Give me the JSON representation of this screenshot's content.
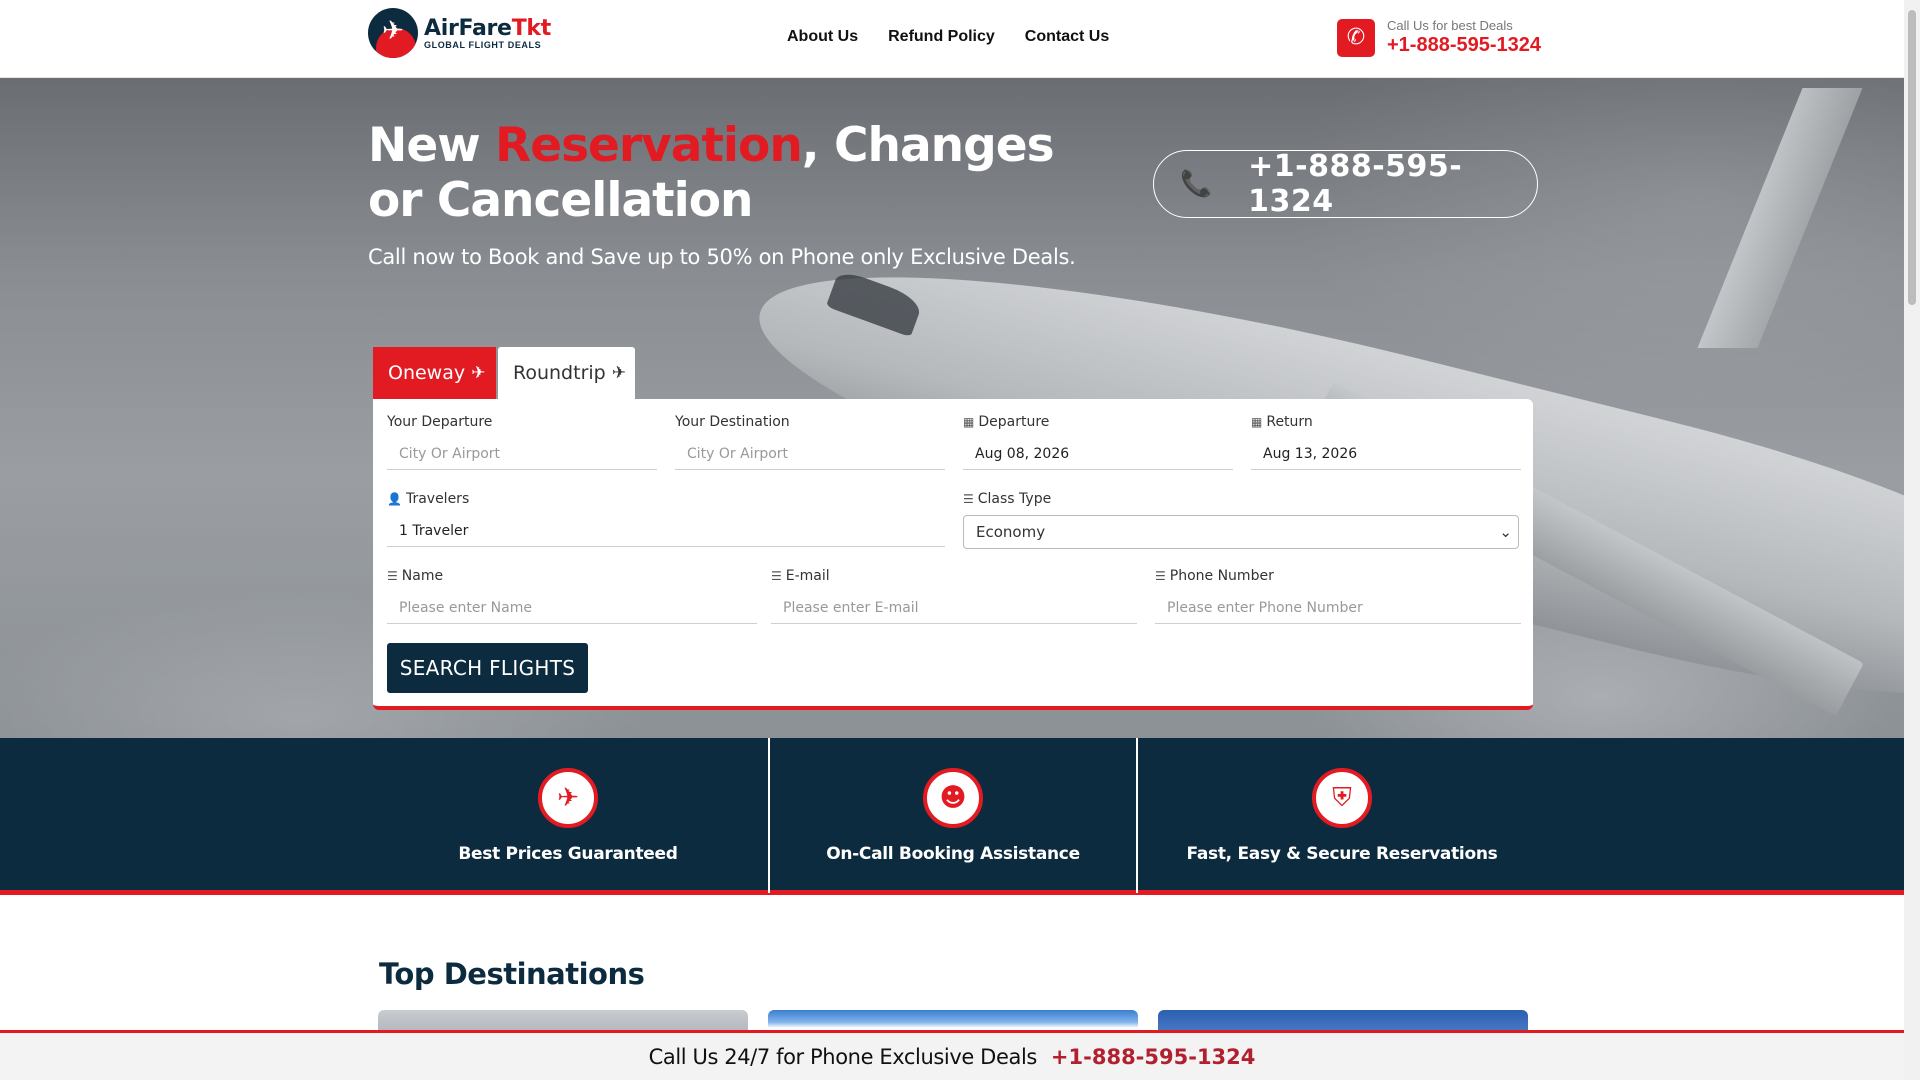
{
  "header": {
    "logo_name_part1": "AirFare",
    "logo_name_part2": "Tkt",
    "logo_tagline": "GLOBAL FLIGHT DEALS",
    "nav": [
      "About Us",
      "Refund Policy",
      "Contact Us"
    ],
    "call_label": "Call Us for best Deals",
    "call_number": "+1-888-595-1324"
  },
  "hero": {
    "title_pre": "New ",
    "title_highlight": "Reservation",
    "title_post": ", Changes or Cancellation",
    "subtitle": "Call now to Book and Save up to 50% on Phone only Exclusive Deals.",
    "phone_number": "+1-888-595-1324"
  },
  "booking": {
    "tabs": [
      "Oneway",
      "Roundtrip"
    ],
    "active_tab": "Oneway",
    "departure_label": "Your Departure",
    "departure_placeholder": "City Or Airport",
    "destination_label": "Your Destination",
    "destination_placeholder": "City Or Airport",
    "depart_date_label": "Departure",
    "depart_date_value": "Aug 08, 2026",
    "return_label": "Return",
    "return_value": "Aug 13, 2026",
    "travelers_label": "Travelers",
    "travelers_value": "1 Traveler",
    "class_label": "Class Type",
    "class_value": "Economy",
    "name_label": "Name",
    "name_placeholder": "Please enter Name",
    "email_label": "E-mail",
    "email_placeholder": "Please enter E-mail",
    "phone_label": "Phone Number",
    "phone_placeholder": "Please enter Phone Number",
    "search_button": "SEARCH FLIGHTS"
  },
  "features": [
    {
      "label": "Best Prices Guaranteed",
      "icon": "ticket-icon"
    },
    {
      "label": "On-Call Booking Assistance",
      "icon": "agent-icon"
    },
    {
      "label": "Fast, Easy & Secure Reservations",
      "icon": "shield-lock-icon"
    }
  ],
  "destinations": {
    "title": "Top Destinations"
  },
  "sticky_bar": {
    "text": "Call Us 24/7 for Phone Exclusive Deals",
    "number": "+1-888-595-1324"
  },
  "colors": {
    "brand_red": "#e21b23",
    "brand_navy": "#0d2b3e"
  }
}
